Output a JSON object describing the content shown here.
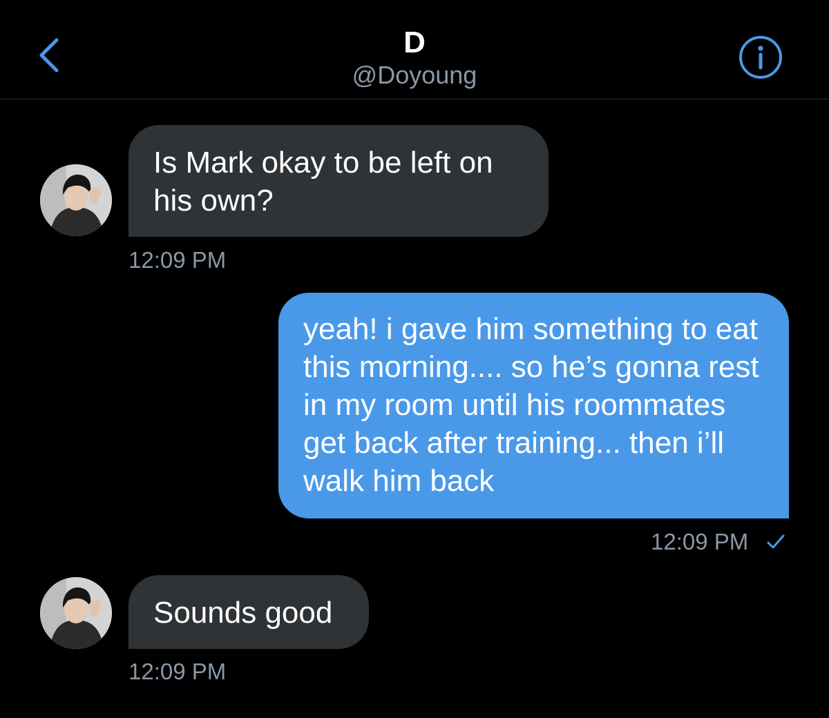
{
  "header": {
    "title": "D",
    "handle": "@Doyoung",
    "back_icon": "chevron-left-icon",
    "info_icon": "info-circle-icon"
  },
  "colors": {
    "background": "#000000",
    "accent": "#4a99e9",
    "incoming_bubble": "#2f3336",
    "muted_text": "#8b98a5"
  },
  "messages": [
    {
      "direction": "incoming",
      "text": "Is Mark okay to be left on his own?",
      "time": "12:09 PM"
    },
    {
      "direction": "outgoing",
      "text": "yeah! i gave him something to eat this morning.... so he’s gonna rest in my room until his roommates get back after training... then i’ll walk him back",
      "time": "12:09 PM",
      "status_icon": "checkmark-icon"
    },
    {
      "direction": "incoming",
      "text": "Sounds good",
      "time": "12:09 PM"
    }
  ]
}
